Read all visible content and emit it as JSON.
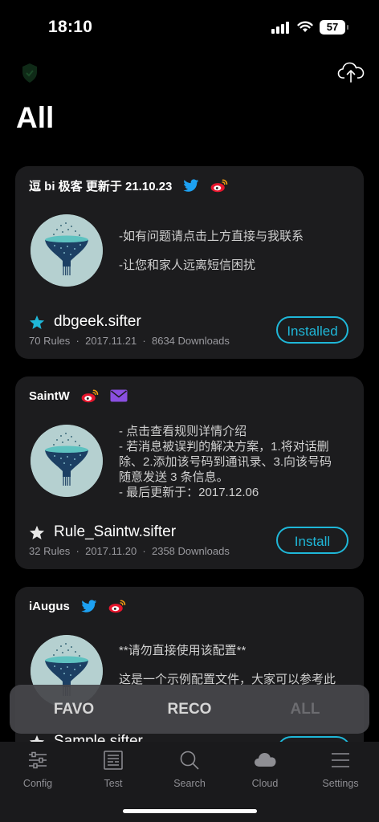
{
  "status_bar": {
    "time": "18:10",
    "battery": "57"
  },
  "page": {
    "title": "All"
  },
  "colors": {
    "accent": "#1fb7d8",
    "card_bg": "#1c1c1e",
    "twitter": "#1da1f2",
    "weibo": "#e6162d",
    "mail": "#8a4fe0",
    "inactive": "#8e8e93"
  },
  "cards": [
    {
      "author": "逗 bi 极客 更新于 21.10.23",
      "header_icons": [
        "twitter-icon",
        "weibo-icon"
      ],
      "description_lines": [
        "-如有问题请点击上方直接与我联系",
        "",
        "-让您和家人远离短信困扰"
      ],
      "starred": true,
      "name": "dbgeek.sifter",
      "rules": "70 Rules",
      "date": "2017.11.21",
      "downloads": "8634 Downloads",
      "button": "Installed"
    },
    {
      "author": "SaintW",
      "header_icons": [
        "weibo-icon",
        "mail-icon"
      ],
      "description_lines": [
        "- 点击查看规则详情介绍",
        "- 若消息被误判的解决方案，1.将对话删",
        "除、2.添加该号码到通讯录、3.向该号码",
        "随意发送 3 条信息。",
        "- 最后更新于：2017.12.06"
      ],
      "starred": false,
      "name": "Rule_Saintw.sifter",
      "rules": "32 Rules",
      "date": "2017.11.20",
      "downloads": "2358 Downloads",
      "button": "Install"
    },
    {
      "author": "iAugus",
      "header_icons": [
        "twitter-icon",
        "weibo-icon"
      ],
      "description_lines": [
        "**请勿直接使用该配置**",
        "",
        "这是一个示例配置文件，大家可以参考此"
      ],
      "starred": false,
      "name": "Sample.sifter"
    }
  ],
  "segments": [
    {
      "label": "FAVO"
    },
    {
      "label": "RECO"
    },
    {
      "label": "ALL",
      "selected": true
    }
  ],
  "tabs": [
    {
      "label": "Config",
      "icon": "sliders-icon"
    },
    {
      "label": "Test",
      "icon": "list-icon"
    },
    {
      "label": "Search",
      "icon": "search-icon"
    },
    {
      "label": "Cloud",
      "icon": "cloud-icon"
    },
    {
      "label": "Settings",
      "icon": "menu-icon"
    }
  ]
}
